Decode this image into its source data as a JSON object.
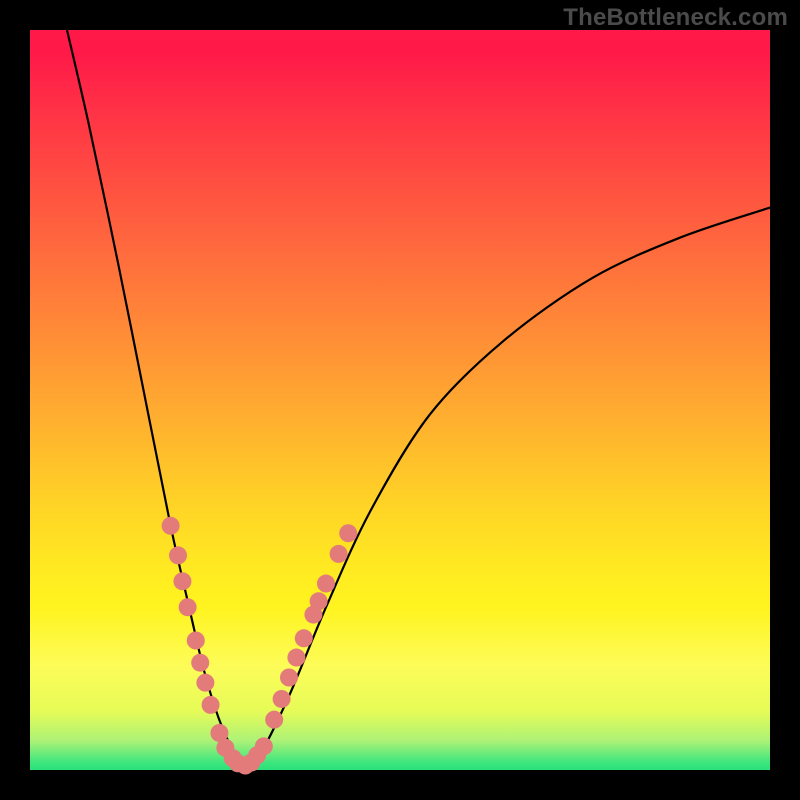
{
  "watermark": "TheBottleneck.com",
  "colors": {
    "frame": "#000000",
    "curve": "#000000",
    "marker_fill": "#e37b7b",
    "marker_stroke": "#b44e4e"
  },
  "chart_data": {
    "type": "line",
    "title": "",
    "xlabel": "",
    "ylabel": "",
    "xlim": [
      0,
      100
    ],
    "ylim": [
      0,
      100
    ],
    "series": [
      {
        "name": "bottleneck-curve",
        "x": [
          5,
          8,
          12,
          16,
          19,
          21.5,
          23.5,
          25.5,
          27.5,
          29,
          31,
          35,
          40,
          46,
          54,
          64,
          76,
          88,
          100
        ],
        "y": [
          100,
          87,
          68,
          48,
          33,
          22,
          13.5,
          7,
          2.5,
          0.5,
          2,
          10,
          22,
          35,
          48,
          58,
          66.5,
          72,
          76
        ]
      }
    ],
    "markers": {
      "name": "highlight-points",
      "points": [
        {
          "x": 19.0,
          "y": 33.0
        },
        {
          "x": 20.0,
          "y": 29.0
        },
        {
          "x": 20.6,
          "y": 25.5
        },
        {
          "x": 21.3,
          "y": 22.0
        },
        {
          "x": 22.4,
          "y": 17.5
        },
        {
          "x": 23.0,
          "y": 14.5
        },
        {
          "x": 23.7,
          "y": 11.8
        },
        {
          "x": 24.4,
          "y": 8.8
        },
        {
          "x": 25.6,
          "y": 5.0
        },
        {
          "x": 26.4,
          "y": 3.0
        },
        {
          "x": 27.4,
          "y": 1.6
        },
        {
          "x": 28.1,
          "y": 0.9
        },
        {
          "x": 29.1,
          "y": 0.6
        },
        {
          "x": 29.9,
          "y": 1.0
        },
        {
          "x": 30.7,
          "y": 2.0
        },
        {
          "x": 31.6,
          "y": 3.2
        },
        {
          "x": 33.0,
          "y": 6.8
        },
        {
          "x": 34.0,
          "y": 9.6
        },
        {
          "x": 35.0,
          "y": 12.5
        },
        {
          "x": 36.0,
          "y": 15.2
        },
        {
          "x": 37.0,
          "y": 17.8
        },
        {
          "x": 38.3,
          "y": 21.0
        },
        {
          "x": 39.0,
          "y": 22.8
        },
        {
          "x": 40.0,
          "y": 25.2
        },
        {
          "x": 41.7,
          "y": 29.2
        },
        {
          "x": 43.0,
          "y": 32.0
        }
      ]
    }
  }
}
